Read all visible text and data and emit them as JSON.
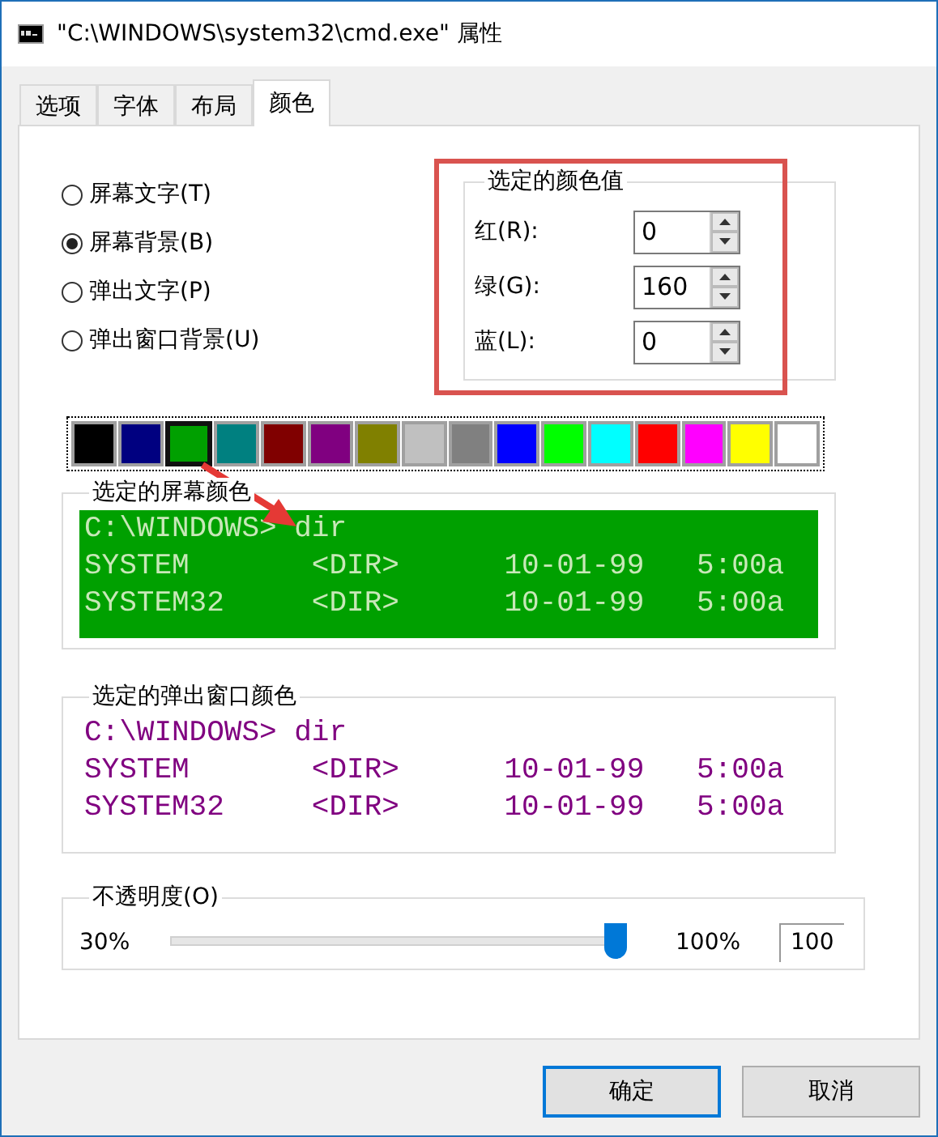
{
  "window": {
    "title": "\"C:\\WINDOWS\\system32\\cmd.exe\" 属性"
  },
  "tabs": [
    {
      "label": "选项",
      "selected": false
    },
    {
      "label": "字体",
      "selected": false
    },
    {
      "label": "布局",
      "selected": false
    },
    {
      "label": "颜色",
      "selected": true
    }
  ],
  "color_targets": [
    {
      "label": "屏幕文字(T)",
      "selected": false
    },
    {
      "label": "屏幕背景(B)",
      "selected": true
    },
    {
      "label": "弹出文字(P)",
      "selected": false
    },
    {
      "label": "弹出窗口背景(U)",
      "selected": false
    }
  ],
  "color_values": {
    "title": "选定的颜色值",
    "fields": [
      {
        "label": "红(R):",
        "value": "0"
      },
      {
        "label": "绿(G):",
        "value": "160"
      },
      {
        "label": "蓝(L):",
        "value": "0"
      }
    ]
  },
  "palette": [
    {
      "color": "#000000",
      "selected": false
    },
    {
      "color": "#000080",
      "selected": false
    },
    {
      "color": "#00a000",
      "selected": true
    },
    {
      "color": "#008080",
      "selected": false
    },
    {
      "color": "#800000",
      "selected": false
    },
    {
      "color": "#800080",
      "selected": false
    },
    {
      "color": "#808000",
      "selected": false
    },
    {
      "color": "#c0c0c0",
      "selected": false
    },
    {
      "color": "#808080",
      "selected": false
    },
    {
      "color": "#0000ff",
      "selected": false
    },
    {
      "color": "#00ff00",
      "selected": false
    },
    {
      "color": "#00ffff",
      "selected": false
    },
    {
      "color": "#ff0000",
      "selected": false
    },
    {
      "color": "#ff00ff",
      "selected": false
    },
    {
      "color": "#ffff00",
      "selected": false
    },
    {
      "color": "#ffffff",
      "selected": false
    }
  ],
  "screen_preview": {
    "title": "选定的屏幕颜色",
    "lines": [
      "C:\\WINDOWS> dir",
      "SYSTEM       <DIR>      10-01-99   5:00a",
      "SYSTEM32     <DIR>      10-01-99   5:00a"
    ]
  },
  "popup_preview": {
    "title": "选定的弹出窗口颜色",
    "lines": [
      "C:\\WINDOWS> dir",
      "SYSTEM       <DIR>      10-01-99   5:00a",
      "SYSTEM32     <DIR>      10-01-99   5:00a"
    ]
  },
  "opacity": {
    "title": "不透明度(O)",
    "min_label": "30%",
    "max_label": "100%",
    "level": 1,
    "value": "100"
  },
  "buttons": [
    "确定",
    "取消"
  ]
}
